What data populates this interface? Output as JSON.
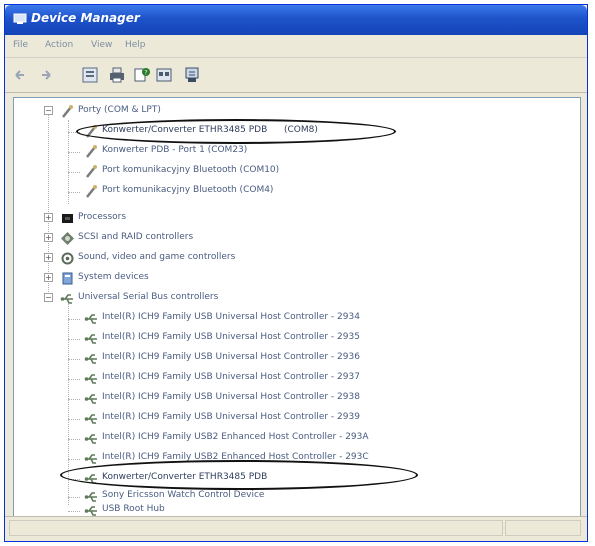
{
  "window": {
    "title": "Device Manager"
  },
  "menu": [
    "File",
    "Action",
    "View",
    "Help"
  ],
  "toolbar": {
    "buttons": [
      "back-icon",
      "forward-icon",
      "properties-icon",
      "print-icon",
      "help-icon",
      "show-hidden-icon",
      "scan-icon"
    ]
  },
  "tree": {
    "ports_group": "Porty (COM & LPT)",
    "ports": [
      "Konwerter/Converter ETHR3485 PDB",
      "Konwerter PDB - Port 1 (COM23)",
      "Port komunikacyjny Bluetooth (COM10)",
      "Port komunikacyjny Bluetooth (COM4)"
    ],
    "ports_first_suffix": "(COM8)",
    "categories": [
      "Processors",
      "SCSI and RAID controllers",
      "Sound, video and game controllers",
      "System devices",
      "Universal Serial Bus controllers"
    ],
    "usb_devices": [
      "Intel(R) ICH9 Family USB Universal Host Controller - 2934",
      "Intel(R) ICH9 Family USB Universal Host Controller - 2935",
      "Intel(R) ICH9 Family USB Universal Host Controller - 2936",
      "Intel(R) ICH9 Family USB Universal Host Controller - 2937",
      "Intel(R) ICH9 Family USB Universal Host Controller - 2938",
      "Intel(R) ICH9 Family USB Universal Host Controller - 2939",
      "Intel(R) ICH9 Family USB2 Enhanced Host Controller - 293A",
      "Intel(R) ICH9 Family USB2 Enhanced Host Controller - 293C",
      "Konwerter/Converter ETHR3485 PDB",
      "Sony Ericsson Watch Control Device",
      "USB Root Hub"
    ]
  }
}
